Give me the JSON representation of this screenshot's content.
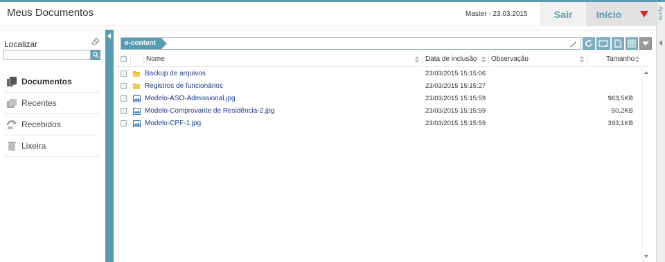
{
  "header": {
    "title": "Meus Documentos",
    "user_info": "Master  -  23.03.2015",
    "logout_label": "Sair",
    "home_label": "Início",
    "menu_icon": "triangle-down-icon",
    "help_label": "Ajuda"
  },
  "sidebar": {
    "search_label": "Localizar",
    "search_value": "",
    "items": [
      {
        "label": "Documentos",
        "icon": "documents-icon",
        "active": true
      },
      {
        "label": "Recentes",
        "icon": "recent-icon",
        "active": false
      },
      {
        "label": "Recebidos",
        "icon": "received-icon",
        "active": false
      },
      {
        "label": "Lixeira",
        "icon": "trash-icon",
        "active": false
      }
    ]
  },
  "main": {
    "breadcrumb": "e-content",
    "columns": {
      "name": "Nome",
      "date": "Data de inclusão",
      "note": "Observação",
      "size": "Tamanho"
    },
    "rows": [
      {
        "type": "folder",
        "name": "Backup de arquivos",
        "date": "23/03/2015 15:15:06",
        "note": "",
        "size": ""
      },
      {
        "type": "folder",
        "name": "Registros de funcionários",
        "date": "23/03/2015 15:15:27",
        "note": "",
        "size": ""
      },
      {
        "type": "image",
        "name": "Modelo-ASO-Admissional.jpg",
        "date": "23/03/2015 15:15:59",
        "note": "",
        "size": "963,5KB"
      },
      {
        "type": "image",
        "name": "Modelo-Comprovante de Residência-2.jpg",
        "date": "23/03/2015 15:15:59",
        "note": "",
        "size": "50,2KB"
      },
      {
        "type": "image",
        "name": "Modelo-CPF-1.jpg",
        "date": "23/03/2015 15:15:59",
        "note": "",
        "size": "393,1KB"
      }
    ]
  },
  "colors": {
    "accent": "#5a9bb4",
    "menu_arrow": "#e0242f",
    "link": "#1b3a8c"
  }
}
